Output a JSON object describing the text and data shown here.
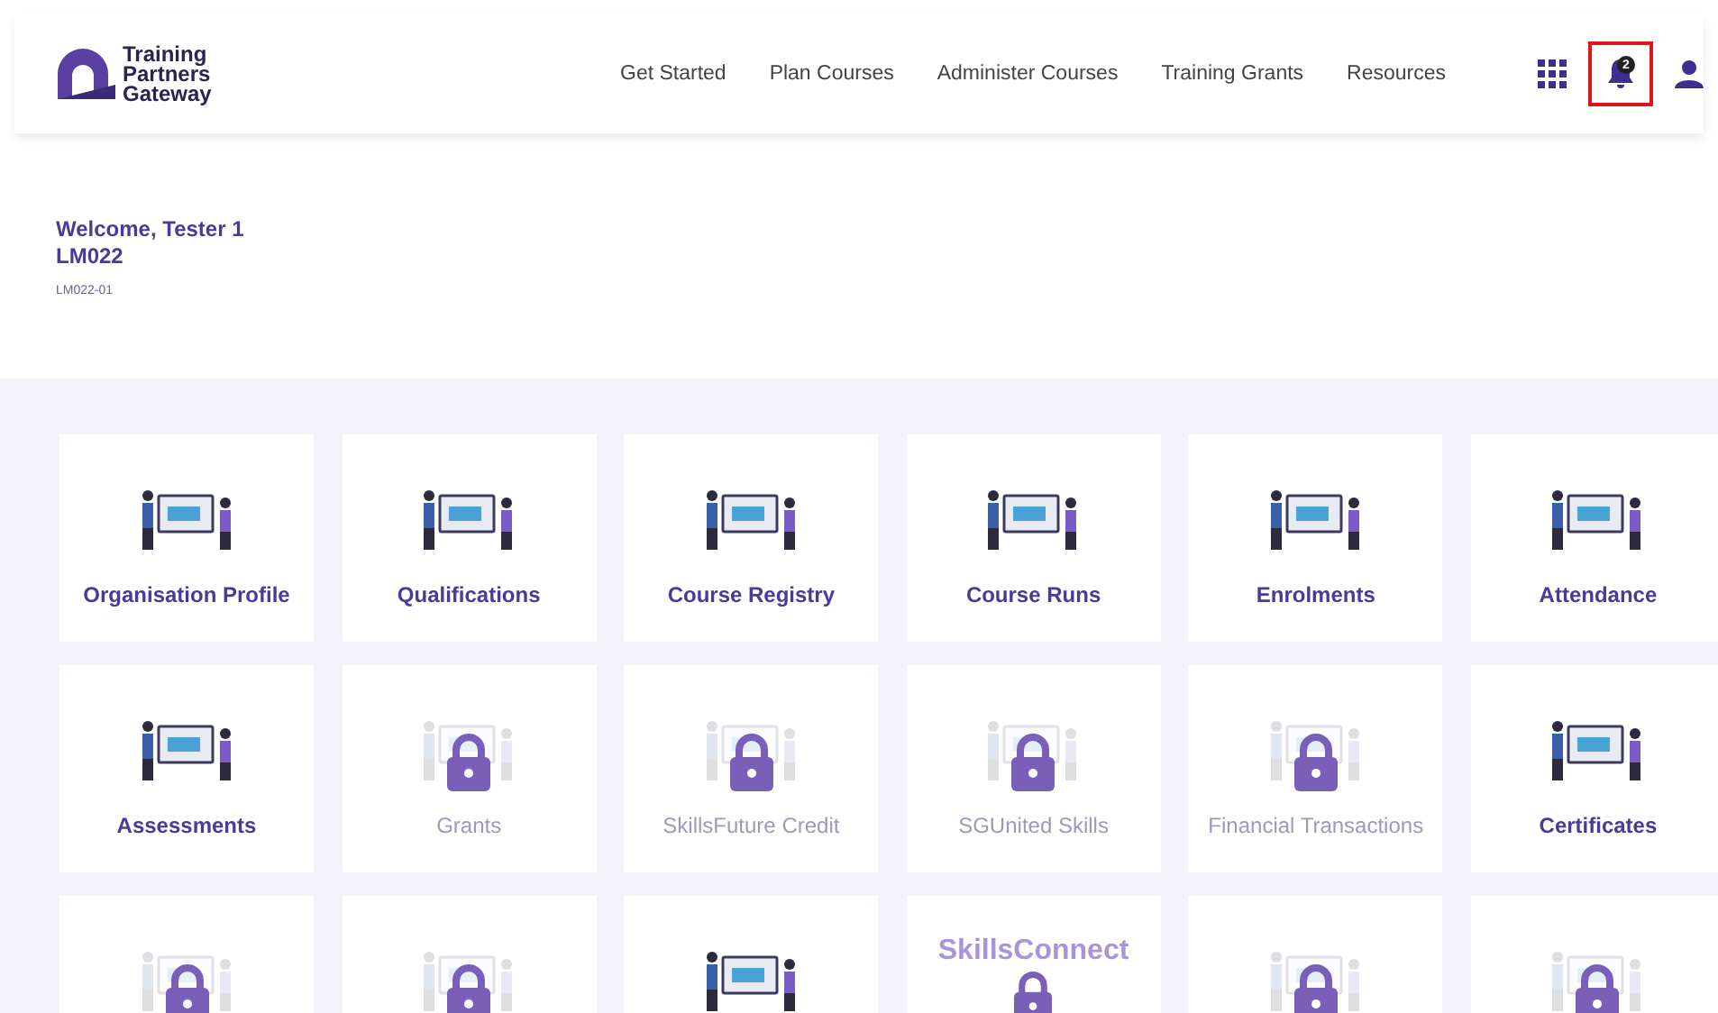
{
  "header": {
    "logo": {
      "lines": [
        "Training",
        "Partners",
        "Gateway"
      ]
    },
    "nav": [
      "Get Started",
      "Plan Courses",
      "Administer Courses",
      "Training Grants",
      "Resources"
    ],
    "notifications": {
      "count": "2",
      "highlighted": true
    }
  },
  "welcome": {
    "greeting": "Welcome, Tester 1",
    "org_code": "LM022",
    "sub_code": "LM022-01"
  },
  "tiles": [
    {
      "label": "Organisation Profile",
      "locked": false
    },
    {
      "label": "Qualifications",
      "locked": false
    },
    {
      "label": "Course Registry",
      "locked": false
    },
    {
      "label": "Course Runs",
      "locked": false
    },
    {
      "label": "Enrolments",
      "locked": false
    },
    {
      "label": "Attendance",
      "locked": false
    },
    {
      "label": "Assessments",
      "locked": false
    },
    {
      "label": "Grants",
      "locked": true
    },
    {
      "label": "SkillsFuture Credit",
      "locked": true
    },
    {
      "label": "SGUnited Skills",
      "locked": true
    },
    {
      "label": "Financial Transactions",
      "locked": true
    },
    {
      "label": "Certificates",
      "locked": false
    },
    {
      "locked": true
    },
    {
      "locked": true
    },
    {
      "locked": false
    },
    {
      "artwork_text": "SkillsConnect",
      "locked": true
    },
    {
      "locked": true
    },
    {
      "locked": true
    }
  ]
}
